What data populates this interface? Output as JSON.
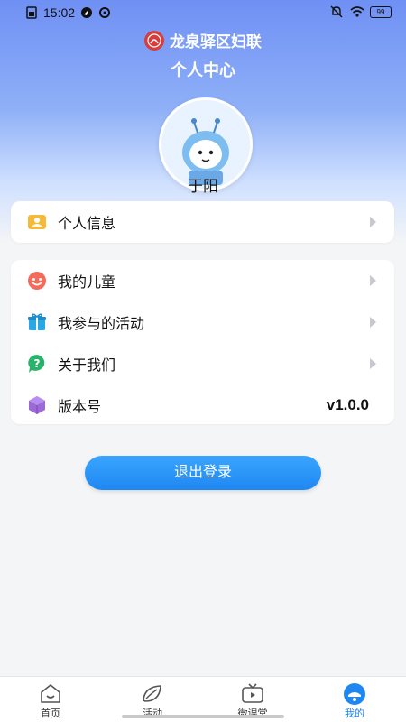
{
  "status_bar": {
    "time": "15:02",
    "battery": "99"
  },
  "brand": {
    "name": "龙泉驿区妇联"
  },
  "page": {
    "title": "个人中心"
  },
  "user": {
    "name": "于阳"
  },
  "menu_primary": [
    {
      "label": "个人信息",
      "icon": "id-card-icon"
    }
  ],
  "menu_secondary": [
    {
      "label": "我的儿童",
      "icon": "smile-face-icon"
    },
    {
      "label": "我参与的活动",
      "icon": "gift-icon"
    },
    {
      "label": "关于我们",
      "icon": "help-chat-icon"
    },
    {
      "label": "版本号",
      "icon": "cube-icon",
      "value": "v1.0.0"
    }
  ],
  "logout": {
    "label": "退出登录"
  },
  "tabs": [
    {
      "label": "首页",
      "icon": "home-icon"
    },
    {
      "label": "活动",
      "icon": "leaf-icon"
    },
    {
      "label": "微课堂",
      "icon": "tv-icon"
    },
    {
      "label": "我的",
      "icon": "profile-icon",
      "active": true
    }
  ],
  "colors": {
    "primary": "#1f87f1",
    "header_top": "#6f90f4"
  }
}
